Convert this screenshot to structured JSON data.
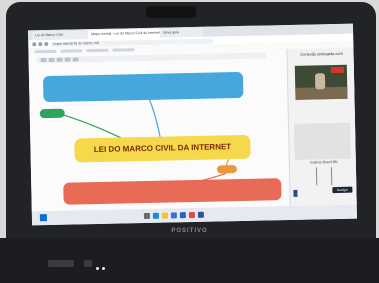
{
  "browser": {
    "tabs": [
      {
        "label": "Lei do Marco Civil"
      },
      {
        "label": "Mapa mental - Lei do Marco Civil da Internet"
      },
      {
        "label": "Nova guia"
      }
    ],
    "address": "mapa mental lei do marco civil"
  },
  "mindmap": {
    "central_topic": "LEI DO MARCO CIVIL DA INTERNET",
    "colors": {
      "blue": "#45a7dc",
      "green": "#2ea35c",
      "yellow": "#f5d84c",
      "orange": "#e9993b",
      "red": "#e86c55"
    }
  },
  "side_panel": {
    "title": "Conexão protegida com",
    "caption": "Galeria Brasil BN",
    "button_label": "Desligar"
  },
  "taskbar": {
    "icons": [
      "start-icon",
      "search-icon",
      "edge-icon",
      "folder-icon",
      "store-icon",
      "mail-icon",
      "chrome-icon",
      "word-icon"
    ]
  }
}
